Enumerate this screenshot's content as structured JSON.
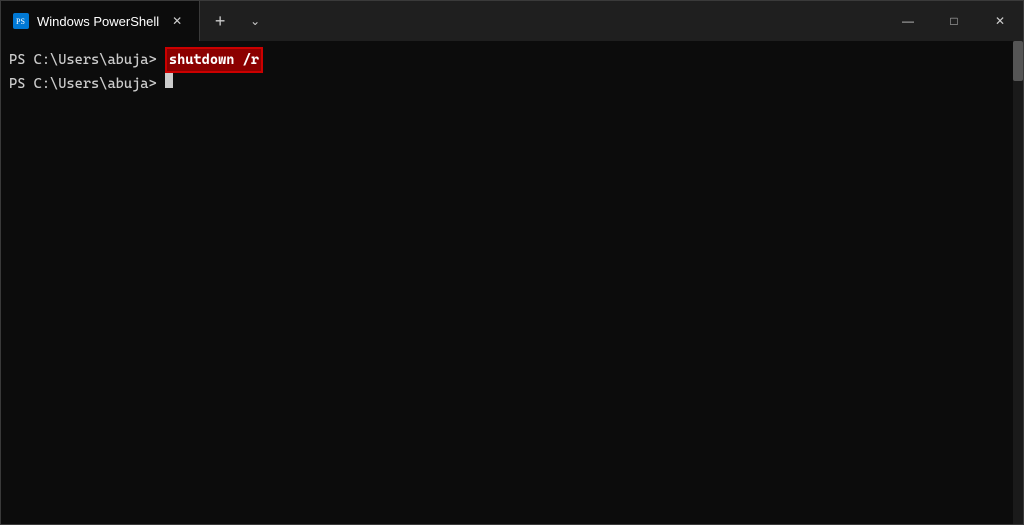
{
  "window": {
    "title": "Windows PowerShell",
    "tab_label": "Windows PowerShell"
  },
  "terminal": {
    "line1_prompt": "PS C:\\Users\\abuja>",
    "line1_command": "shutdown /r",
    "line2_prompt": "PS C:\\Users\\abuja>",
    "line2_cursor": ""
  },
  "controls": {
    "minimize": "—",
    "maximize": "□",
    "close": "✕",
    "new_tab": "+",
    "dropdown": "⌄"
  }
}
